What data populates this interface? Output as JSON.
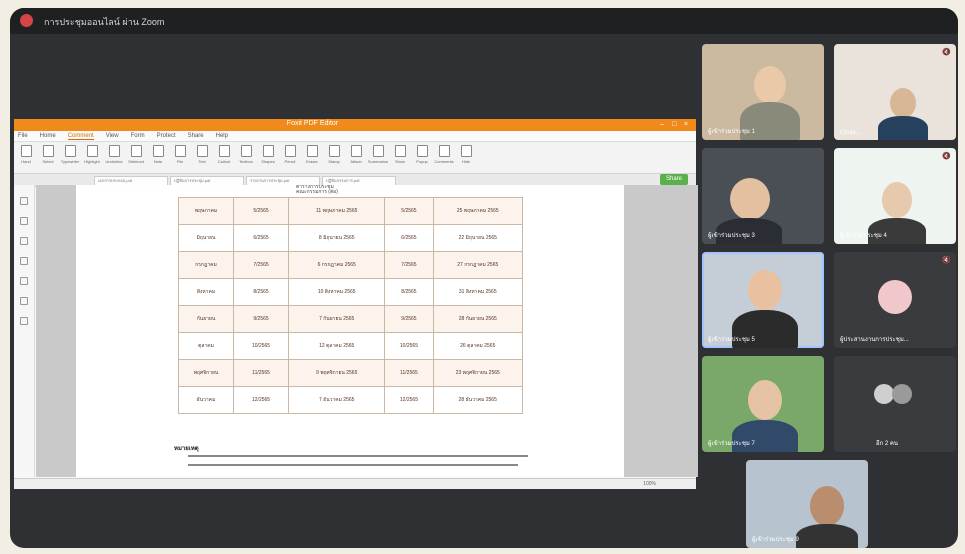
{
  "meeting": {
    "title": "การประชุมออนไลน์ ผ่าน Zoom"
  },
  "shared_app": {
    "window_title": "Foxit PDF Editor",
    "menu": [
      "File",
      "Home",
      "Comment",
      "View",
      "Form",
      "Protect",
      "Share",
      "Help"
    ],
    "active_menu_index": 2,
    "ribbon": [
      "Hand",
      "Select",
      "Typewriter",
      "Highlight",
      "Underline",
      "Strikeout",
      "Note",
      "File",
      "Text",
      "Callout",
      "Textbox",
      "Shapes",
      "Pencil",
      "Eraser",
      "Stamp",
      "Attach",
      "Summarize",
      "Show",
      "Popup",
      "Comments",
      "Hide"
    ],
    "doc_tabs": [
      "เอกสารประกอบ.pdf",
      "ปฏิทินการประชุม.pdf",
      "รายงานการประชุม.pdf",
      "ปฏิทินกรรมการ.pdf"
    ],
    "green_button": "Share"
  },
  "document": {
    "header_line1": "ตารางการประชุม",
    "header_line2": "คณะกรรมการ (ต่อ)",
    "rows": [
      {
        "month": "พฤษภาคม",
        "no": "5/2565",
        "date": "11 พฤษภาคม 2565",
        "no2": "5/2565",
        "date2": "25 พฤษภาคม 2565"
      },
      {
        "month": "มิถุนายน",
        "no": "6/2565",
        "date": "8 มิถุนายน 2565",
        "no2": "6/2565",
        "date2": "22 มิถุนายน 2565"
      },
      {
        "month": "กรกฎาคม",
        "no": "7/2565",
        "date": "6 กรกฎาคม 2565",
        "no2": "7/2565",
        "date2": "27 กรกฎาคม 2565"
      },
      {
        "month": "สิงหาคม",
        "no": "8/2565",
        "date": "10 สิงหาคม 2565",
        "no2": "8/2565",
        "date2": "31 สิงหาคม 2565"
      },
      {
        "month": "กันยายน",
        "no": "9/2565",
        "date": "7 กันยายน 2565",
        "no2": "9/2565",
        "date2": "28 กันยายน 2565"
      },
      {
        "month": "ตุลาคม",
        "no": "10/2565",
        "date": "12 ตุลาคม 2565",
        "no2": "10/2565",
        "date2": "26 ตุลาคม 2565"
      },
      {
        "month": "พฤศจิกายน",
        "no": "11/2565",
        "date": "9 พฤศจิกายน 2565",
        "no2": "11/2565",
        "date2": "23 พฤศจิกายน 2565"
      },
      {
        "month": "ธันวาคม",
        "no": "12/2565",
        "date": "7 ธันวาคม 2565",
        "no2": "12/2565",
        "date2": "28 ธันวาคม 2565"
      }
    ],
    "note_title": "หมายเหตุ"
  },
  "status": {
    "zoom": "100%"
  },
  "participants": [
    {
      "name": "ผู้เข้าร่วมประชุม 1"
    },
    {
      "name": "Chula..."
    },
    {
      "name": "ผู้เข้าร่วมประชุม 3"
    },
    {
      "name": "ผู้เข้าร่วมประชุม 4"
    },
    {
      "name": "ผู้เข้าร่วมประชุม 5"
    },
    {
      "name": "ผู้ประสานงานการประชุม..."
    },
    {
      "name": "ผู้เข้าร่วมประชุม 7"
    },
    {
      "name": "อีก 2 คน"
    },
    {
      "name": "ผู้เข้าร่วมประชุม 9"
    }
  ],
  "colors": {
    "accent": "#f08b1b",
    "zoom_bg": "#2f3033",
    "highlight": "#9fc4ff"
  }
}
